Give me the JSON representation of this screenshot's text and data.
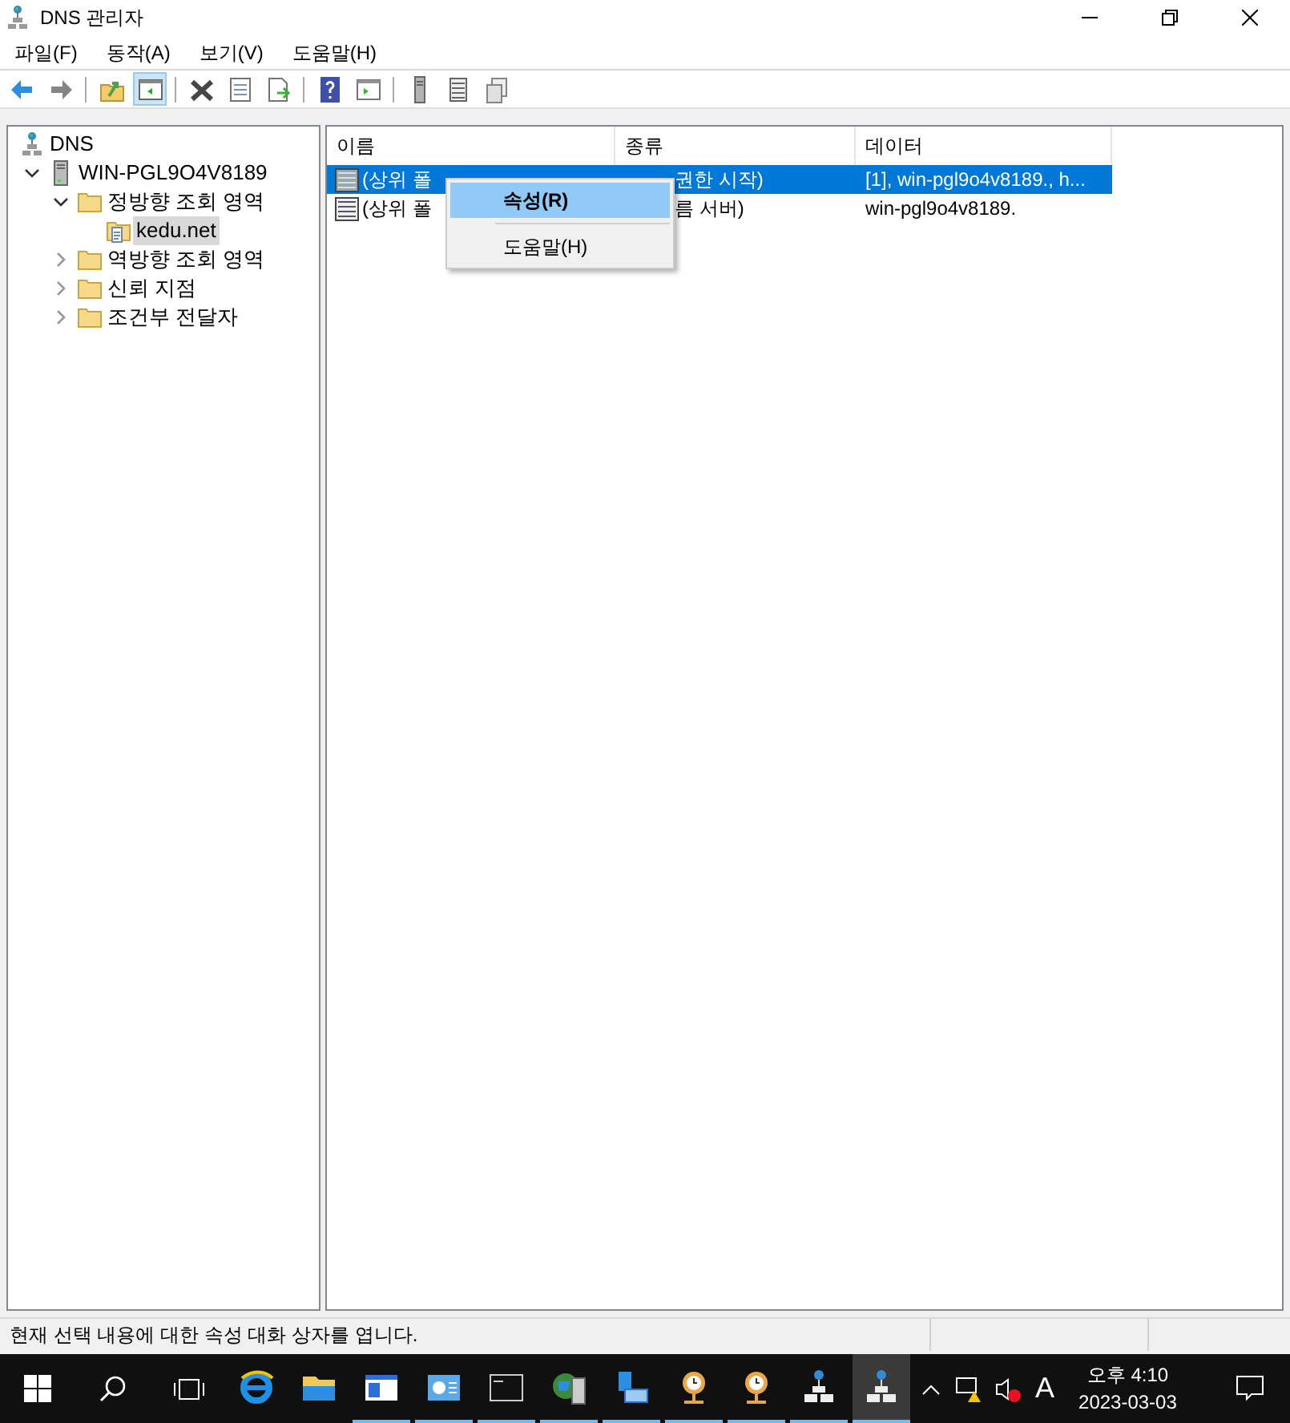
{
  "window": {
    "title": "DNS 관리자"
  },
  "menu": [
    "파일(F)",
    "동작(A)",
    "보기(V)",
    "도움말(H)"
  ],
  "toolbar": [
    {
      "kind": "back",
      "on": true
    },
    {
      "kind": "forward",
      "on": false
    },
    {
      "kind": "sep"
    },
    {
      "kind": "up",
      "on": false
    },
    {
      "kind": "pane",
      "on": true
    },
    {
      "kind": "sep"
    },
    {
      "kind": "delete",
      "on": false
    },
    {
      "kind": "props",
      "on": false
    },
    {
      "kind": "export",
      "on": false
    },
    {
      "kind": "sep"
    },
    {
      "kind": "help",
      "on": false
    },
    {
      "kind": "pane2",
      "on": false
    },
    {
      "kind": "sep"
    },
    {
      "kind": "server",
      "on": false
    },
    {
      "kind": "list",
      "on": false
    },
    {
      "kind": "copy",
      "on": false
    }
  ],
  "tree": [
    {
      "label": "DNS",
      "kind": "dns",
      "selected": false,
      "children": [
        {
          "label": "WIN-PGL9O4V8189",
          "kind": "server",
          "selected": false,
          "expanded": true,
          "children": [
            {
              "label": "정방향 조회 영역",
              "kind": "folder",
              "selected": false,
              "expanded": true,
              "children": [
                {
                  "label": "kedu.net",
                  "kind": "zone",
                  "selected": true
                }
              ]
            },
            {
              "label": "역방향 조회 영역",
              "kind": "folder",
              "selected": false,
              "expanded": false
            },
            {
              "label": "신뢰 지점",
              "kind": "folder",
              "selected": false,
              "expanded": false
            },
            {
              "label": "조건부 전달자",
              "kind": "folder",
              "selected": false,
              "expanded": false
            }
          ]
        }
      ]
    }
  ],
  "table": {
    "columns": [
      "이름",
      "종류",
      "데이터"
    ],
    "rows": [
      {
        "kind": "soa",
        "name": "(상위 폴",
        "type": "권한 시작)",
        "data": "[1], win-pgl9o4v8189., h...",
        "selected": true
      },
      {
        "kind": "ns",
        "name": "(상위 폴",
        "type": "름 서버)",
        "data": "win-pgl9o4v8189.",
        "selected": false
      }
    ]
  },
  "context_menu": [
    {
      "label": "속성(R)",
      "selected": true
    },
    {
      "label": "도움말(H)",
      "selected": false
    }
  ],
  "status_bar": "현재 선택 내용에 대한 속성 대화 상자를 엽니다.",
  "taskbar": {
    "apps": [
      {
        "kind": "browser",
        "running": false,
        "selected": false
      },
      {
        "kind": "folder",
        "running": false,
        "selected": false
      },
      {
        "kind": "window",
        "running": true,
        "selected": false
      },
      {
        "kind": "dashboard",
        "running": true,
        "selected": false
      },
      {
        "kind": "terminal",
        "running": true,
        "selected": false
      },
      {
        "kind": "globe",
        "running": true,
        "selected": false
      },
      {
        "kind": "network",
        "running": true,
        "selected": false
      },
      {
        "kind": "clock",
        "running": true,
        "selected": false
      },
      {
        "kind": "clock",
        "running": true,
        "selected": false
      },
      {
        "kind": "dns",
        "running": true,
        "selected": false
      },
      {
        "kind": "dns",
        "running": true,
        "selected": true
      }
    ],
    "input_mode": "A",
    "time": "오후 4:10",
    "date": "2023-03-03"
  }
}
